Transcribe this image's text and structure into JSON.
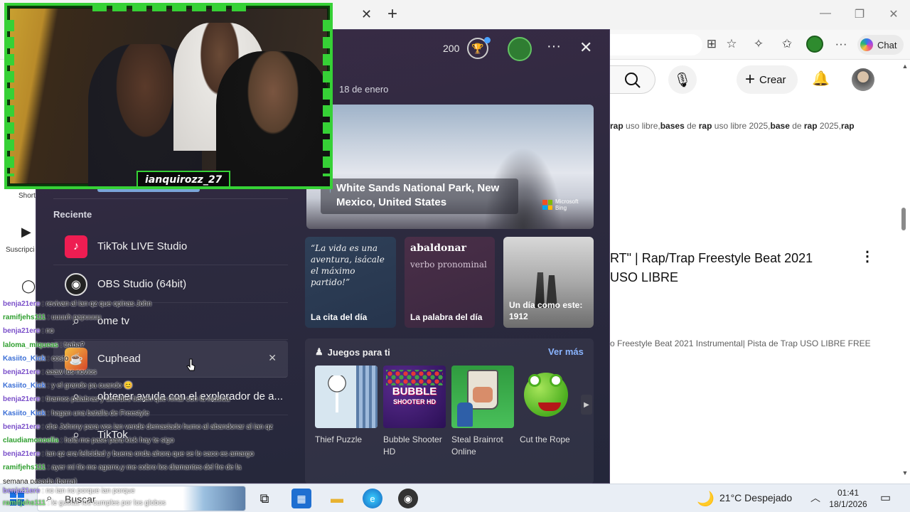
{
  "browser": {
    "tab_close": "✕",
    "tab_new": "+",
    "window": {
      "minimize": "—",
      "maximize": "❐",
      "close": "✕"
    },
    "toolbar": {
      "chat_label": "Chat",
      "more": "···"
    }
  },
  "youtube": {
    "create_label": "Crear",
    "tags": [
      {
        "t": "rap",
        "b": true
      },
      {
        "t": " uso libre,",
        "b": false
      },
      {
        "t": "bases",
        "b": true
      },
      {
        "t": " de ",
        "b": false
      },
      {
        "t": "rap",
        "b": true
      },
      {
        "t": " uso libre 2025,",
        "b": false
      },
      {
        "t": "base",
        "b": true
      },
      {
        "t": " de ",
        "b": false
      },
      {
        "t": "rap",
        "b": true
      },
      {
        "t": " 2025,",
        "b": false
      },
      {
        "t": "rap",
        "b": true
      }
    ],
    "video_title": "RT\" | Rap/Trap Freestyle Beat 2021 USO LIBRE",
    "video_desc": "o Freestyle Beat 2021 Instrumental| Pista de Trap USO LIBRE FREE",
    "nav": {
      "shorts": "Short",
      "subs": "Suscripci"
    }
  },
  "panel": {
    "points": "200",
    "date": "18 de enero",
    "hero_caption": "White Sands National Park, New Mexico, United States",
    "hero_brand_1": "Microsoft",
    "hero_brand_2": "Bing",
    "quote_text": "“La vida es una aventura, isácale el máximo partido!”",
    "quote_label": "La cita del día",
    "word_title": "abaldonar",
    "word_sub": "verbo pronominal",
    "word_label": "La palabra del día",
    "day_label_1": "Un día como este:",
    "day_label_2": "1912",
    "recent_title": "Reciente",
    "recent": [
      {
        "label": "TikTok LIVE Studio"
      },
      {
        "label": "OBS Studio (64bit)"
      },
      {
        "label": "ome tv"
      },
      {
        "label": "Cuphead"
      },
      {
        "label": "obtener ayuda con el explorador de a..."
      },
      {
        "label": "TikTok"
      }
    ],
    "games_title": "Juegos para ti",
    "games_more": "Ver más",
    "games": [
      {
        "name": "Thief Puzzle"
      },
      {
        "name": "Bubble Shooter HD"
      },
      {
        "name": "Steal Brainrot Online"
      },
      {
        "name": "Cut the Rope"
      }
    ],
    "bubble_logo": "BUBBLE",
    "bubble_logo_sub": "SHOOTER HD"
  },
  "cam": {
    "streamer_name": "ianquirozz_27"
  },
  "chat": [
    {
      "user": "benja21ere",
      "color": "#7a4fc9",
      "msg": ": revivan al ian qz que opinas John"
    },
    {
      "user": "ramifjehs111",
      "color": "#2e9e2e",
      "msg": ": uuuuh papuuuu"
    },
    {
      "user": "benja21ere",
      "color": "#7a4fc9",
      "msg": ": no"
    },
    {
      "user": "laloma_miqueas",
      "color": "#2e9e2e",
      "msg": ": traba?"
    },
    {
      "user": "Kasiito_Kick",
      "color": "#3b6fd6",
      "msg": ": costo"
    },
    {
      "user": "benja21ere",
      "color": "#7a4fc9",
      "msg": ": aaaw los novios"
    },
    {
      "user": "Kasiito_Kick",
      "color": "#3b6fd6",
      "msg": ": y el grande pa cuando 😊"
    },
    {
      "user": "benja21ere",
      "color": "#7a4fc9",
      "msg": ": tiramos palabras y ustedes tienen que rimar con la musica"
    },
    {
      "user": "Kasiito_Kick",
      "color": "#3b6fd6",
      "msg": ": hagan una batalla de Freestyle"
    },
    {
      "user": "benja21ere",
      "color": "#7a4fc9",
      "msg": ": che Johnny para vos ian vende demasiado humo al abandonar al ian qz"
    },
    {
      "user": "claudiamonoelia",
      "color": "#2e9e2e",
      "msg": ": hola me pase para kick hay te sigo"
    },
    {
      "user": "benja21ere",
      "color": "#7a4fc9",
      "msg": ": ian qz era felicidad y buena onda ahora que se lo saco es amargo"
    },
    {
      "user": "ramifjehs111",
      "color": "#2e9e2e",
      "msg": ": ayer mi tío me agarro,y me cobro los diamantes del fre de la"
    },
    {
      "user": "",
      "color": "#111111",
      "msg": "semana pasada (barra)"
    }
  ],
  "chat_bottom": [
    {
      "user": "benja21ere",
      "color": "#b49cff",
      "msg": ": no ian no porque ian porque"
    },
    {
      "user": "ramifjehs111",
      "color": "#7be37b",
      "msg": ": le gustas los cumples por los globos"
    }
  ],
  "taskbar": {
    "search_label": "Buscar",
    "weather": "21°C  Despejado",
    "time": "01:41",
    "date": "18/1/2026"
  }
}
